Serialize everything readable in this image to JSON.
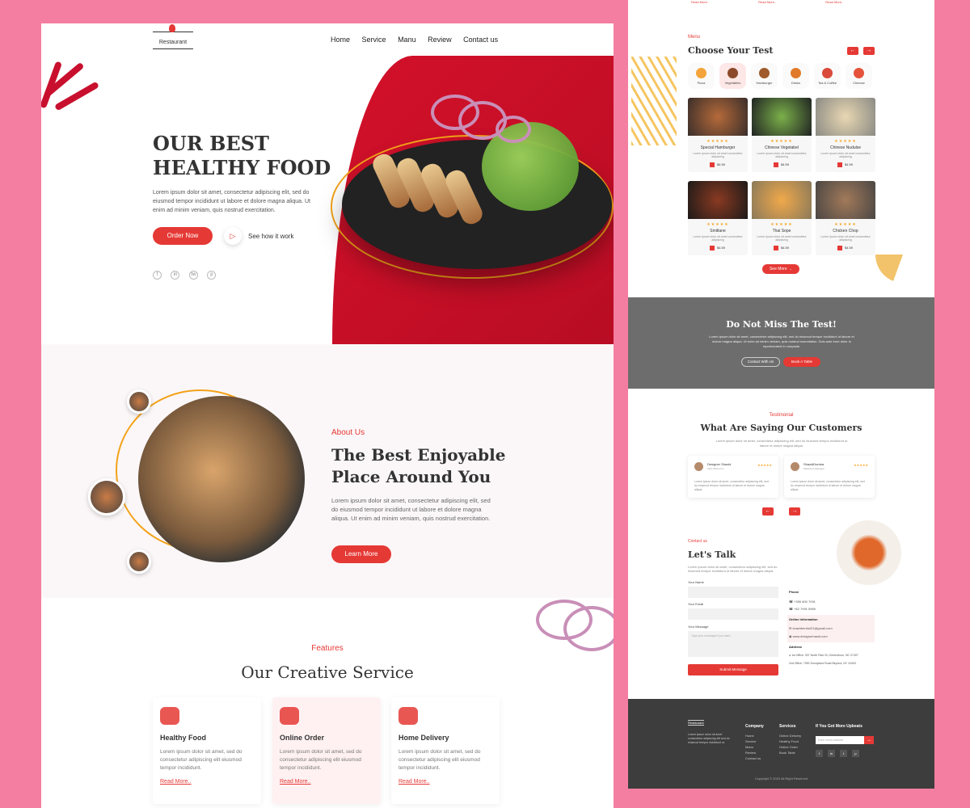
{
  "colors": {
    "accent": "#e53935",
    "background": "#f47ea1",
    "star": "#f5a623"
  },
  "left": {
    "logo": "Restaurant",
    "nav": [
      "Home",
      "Service",
      "Manu",
      "Review",
      "Contact us"
    ],
    "hero": {
      "title_line1": "OUR BEST",
      "title_line2": "HEALTHY FOOD",
      "text": "Lorem ipsum dolor sit amet, consectetur adipiscing elit, sed do eiusmod tempor incididunt ut labore et dolore magna aliqua. Ut enim ad minim veniam, quis nostrud exercitation.",
      "order_button": "Order Now",
      "play_icon": "play-icon",
      "how_link": "See how it work",
      "socials": [
        "f",
        "in",
        "tw",
        "p"
      ]
    },
    "about": {
      "label": "About Us",
      "title_line1": "The Best Enjoyable",
      "title_line2": "Place Around You",
      "text": "Lorem ipsum dolor sit amet, consectetur adipiscing elit, sed do eiusmod tempor incididunt ut labore et dolore magna aliqua. Ut enim ad minim veniam, quis nostrud exercitation.",
      "button": "Learn More"
    },
    "features": {
      "label": "Features",
      "title": "Our Creative Service",
      "cards": [
        {
          "title": "Healthy Food",
          "text": "Lorem ipsum dolor sit amet, sed do consectetur adipiscing elit eiusmod tempor incididunt.",
          "link": "Read More..",
          "icon": "bowl-icon"
        },
        {
          "title": "Online Order",
          "text": "Lorem ipsum dolor sit amet, sed do consectetur adipiscing elit eiusmod tempor incididunt.",
          "link": "Read More..",
          "icon": "shopping-bag-icon"
        },
        {
          "title": "Home Delivery",
          "text": "Lorem ipsum dolor sit amet, sed do consectetur adipiscing elit eiusmod tempor incididunt.",
          "link": "Read More..",
          "icon": "delivery-scooter-icon"
        }
      ]
    }
  },
  "right": {
    "top_links": [
      "Read More..",
      "Read More..",
      "Read More.."
    ],
    "menu": {
      "label": "Menu",
      "title": "Choose Your Test",
      "prev": "←",
      "next": "→",
      "categories": [
        "Pizza",
        "Vegetables",
        "Hamburger",
        "Drinks",
        "Tea & Coffee",
        "Chinese"
      ],
      "items": [
        {
          "name": "Special Hamburger",
          "price": "$4.59",
          "stars": "★★★★★",
          "desc": "Lorem ipsum dolor sit amet consectetur adipiscing"
        },
        {
          "name": "Chinese Vegetabel",
          "price": "$4.59",
          "stars": "★★★★★",
          "desc": "Lorem ipsum dolor sit amet consectetur adipiscing"
        },
        {
          "name": "Chinese Nudulse",
          "price": "$4.59",
          "stars": "★★★★★",
          "desc": "Lorem ipsum dolor sit amet consectetur adipiscing"
        },
        {
          "name": "Smitlane",
          "price": "$4.59",
          "stars": "★★★★★",
          "desc": "Lorem ipsum dolor sit amet consectetur adipiscing"
        },
        {
          "name": "Thai Sope",
          "price": "$4.59",
          "stars": "★★★★★",
          "desc": "Lorem ipsum dolor sit amet consectetur adipiscing"
        },
        {
          "name": "Chicken Chop",
          "price": "$4.59",
          "stars": "★★★★★",
          "desc": "Lorem ipsum dolor sit amet consectetur adipiscing"
        }
      ],
      "see_more": "See More  →"
    },
    "dnm": {
      "title": "Do Not Miss The Test!",
      "text": "Lorem ipsum dolor sit amet, consectetur adipiscing elit, sed do eiusmod tempor incididunt ut labore et dolore magna aliqua. Ut enim ad minim veniam, quis nostrud exercitation. Duis aute irure dolor in reprehenderit in voluptate.",
      "contact_button": "Contact With Us",
      "book_button": "Book A Table"
    },
    "testimonial": {
      "label": "Testimonial",
      "title": "What Are Saying Our Customers",
      "subtitle": "Lorem ipsum dolor sit amet, consectetur adipiscing elit, sed do eiusmod tempor incididunt ut labore et dolore magna aliqua.",
      "cards": [
        {
          "name": "Designer Shazid",
          "role": "CEO Shizul Inc.",
          "stars": "★★★★★",
          "text": "Lorem ipsum dolor sit amet, consectetur adipiscing elit, sed do eiusmod tempor incididunt ut labore et dolore magna aliqua."
        },
        {
          "name": "ShazidDumba",
          "role": "Marketers Manager",
          "stars": "★★★★★",
          "text": "Lorem ipsum dolor sit amet, consectetur adipiscing elit, sed do eiusmod tempor incididunt ut labore et dolore magna aliqua."
        }
      ]
    },
    "contact": {
      "label": "Contact us",
      "title": "Let's Talk",
      "subtitle": "Lorem ipsum dolor sit amet, consectetur adipiscing elit, sed do eiusmod tempor incididunt ut labore et dolore magna aliqua.",
      "name_label": "Your Name",
      "email_label": "Your Email",
      "message_label": "Your Message",
      "message_placeholder": "Type your message if you want...",
      "submit": "Submit Message",
      "phone_heading": "Phone",
      "phone1": "+356 800 7091",
      "phone2": "+82 7991 5969",
      "online_heading": "Online Information",
      "email1": "shazidmridul21@gmail.com",
      "website": "www.designerhasid.com",
      "address_heading": "Address",
      "address1": "1st Office: 307 North Park St, Greensboro, NC 27407",
      "address2": "2nd Office: 7990 Sunnyland Road Beyond, NY 10493"
    },
    "footer": {
      "logo": "Restaurant",
      "about": "Lorem ipsum dolor sit amet consectetur adipiscing elit sed do eiusmod tempor incididunt ut.",
      "company_heading": "Company",
      "company": [
        "Home",
        "Service",
        "Manu",
        "Review",
        "Contact us"
      ],
      "services_heading": "Services",
      "services": [
        "Online Delivery",
        "Healthy Food",
        "Online Order",
        "Book Table"
      ],
      "updates_heading": "If You Got More Upbeats",
      "email_placeholder": "Enter email address",
      "copyright": "Copyright © 2020 All Right Reserved"
    }
  }
}
